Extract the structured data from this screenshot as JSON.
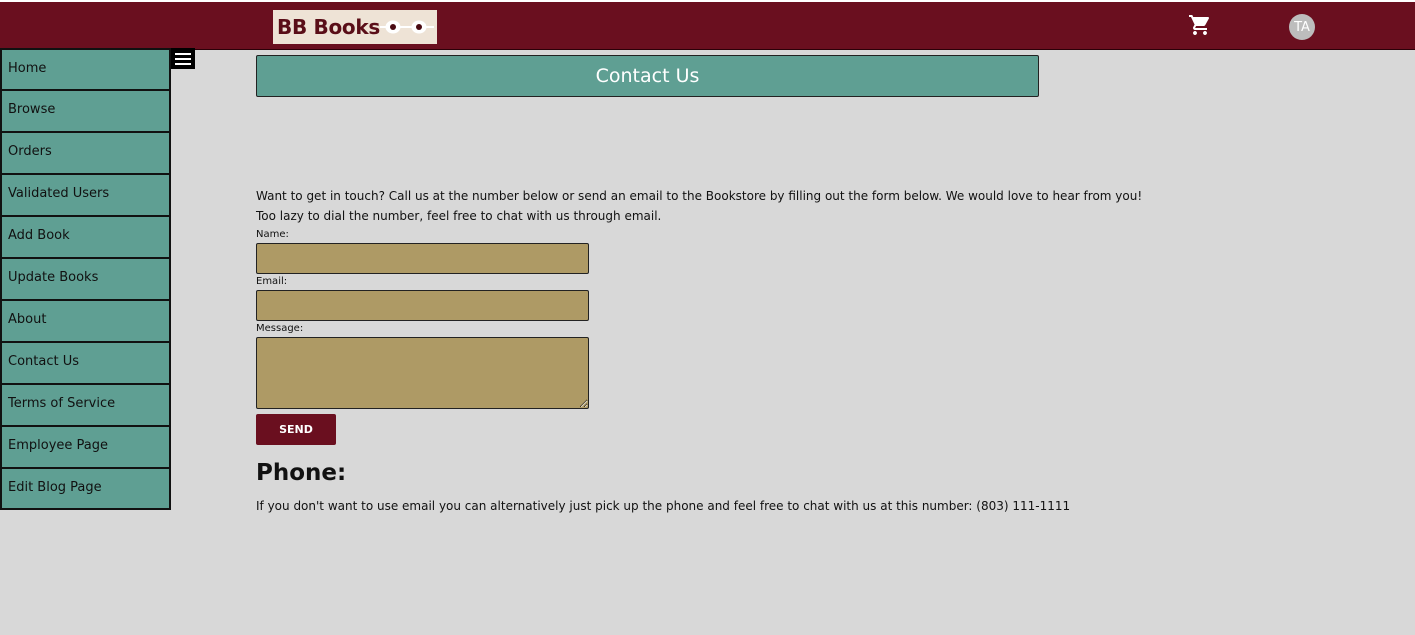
{
  "header": {
    "logo_text": "BB Books",
    "avatar_initials": "TA",
    "cart_icon": "cart-icon",
    "brand_color": "#6a0f1f"
  },
  "sidebar": {
    "items": [
      {
        "label": "Home"
      },
      {
        "label": "Browse"
      },
      {
        "label": "Orders"
      },
      {
        "label": "Validated Users"
      },
      {
        "label": "Add Book"
      },
      {
        "label": "Update Books"
      },
      {
        "label": "About"
      },
      {
        "label": "Contact Us"
      },
      {
        "label": "Terms of Service"
      },
      {
        "label": "Employee Page"
      },
      {
        "label": "Edit Blog Page"
      }
    ],
    "toggle_icon": "hamburger-menu-icon",
    "color": "#5f9f93"
  },
  "main": {
    "title": "Contact Us",
    "intro_line1": "Want to get in touch? Call us at the number below or send an email to the Bookstore by filling out the form below. We would love to hear from you!",
    "intro_line2": "Too lazy to dial the number, feel free to chat with us through email.",
    "form": {
      "name_label": "Name:",
      "name_value": "",
      "email_label": "Email:",
      "email_value": "",
      "message_label": "Message:",
      "message_value": "",
      "send_label": "SEND",
      "field_color": "#ae9a65"
    },
    "phone_heading": "Phone:",
    "phone_text": "If you don't want to use email you can alternatively just pick up the phone and feel free to chat with us at this number: (803) 111-1111"
  }
}
